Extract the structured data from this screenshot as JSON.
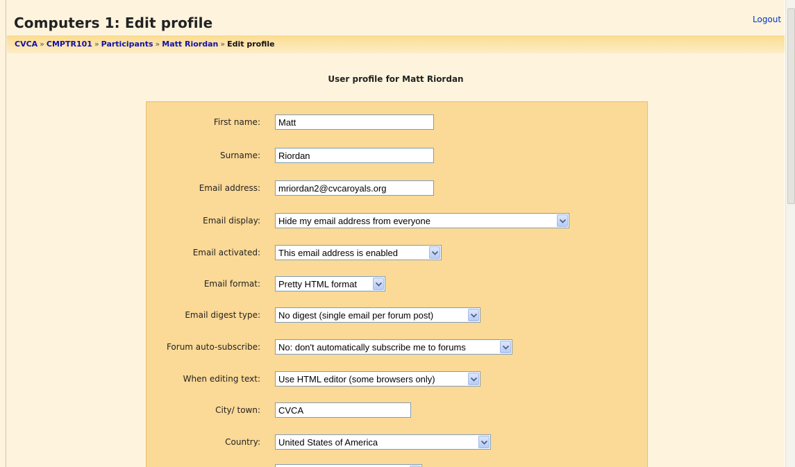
{
  "header": {
    "title": "Computers 1: Edit profile",
    "logout_label": "Logout"
  },
  "breadcrumb": {
    "items": [
      "CVCA",
      "CMPTR101",
      "Participants",
      "Matt Riordan"
    ],
    "current": "Edit profile",
    "separator": "»"
  },
  "main": {
    "heading": "User profile for Matt Riordan"
  },
  "form": {
    "first_name": {
      "label": "First name:",
      "value": "Matt"
    },
    "surname": {
      "label": "Surname:",
      "value": "Riordan"
    },
    "email_address": {
      "label": "Email address:",
      "value": "mriordan2@cvcaroyals.org"
    },
    "email_display": {
      "label": "Email display:",
      "value": "Hide my email address from everyone"
    },
    "email_activated": {
      "label": "Email activated:",
      "value": "This email address is enabled"
    },
    "email_format": {
      "label": "Email format:",
      "value": "Pretty HTML format"
    },
    "email_digest": {
      "label": "Email digest type:",
      "value": "No digest (single email per forum post)"
    },
    "forum_autosubscribe": {
      "label": "Forum auto-subscribe:",
      "value": "No: don't automatically subscribe me to forums"
    },
    "editing_text": {
      "label": "When editing text:",
      "value": "Use HTML editor (some browsers only)"
    },
    "city": {
      "label": "City/ town:",
      "value": "CVCA"
    },
    "country": {
      "label": "Country:",
      "value": "United States of America"
    }
  },
  "colors": {
    "page_background": "#FEF4DE",
    "form_panel": "#FBD996",
    "navbar": "#FBDC8E",
    "link": "#1111AA"
  },
  "icons": {
    "dropdown": "chevron-down-icon"
  }
}
